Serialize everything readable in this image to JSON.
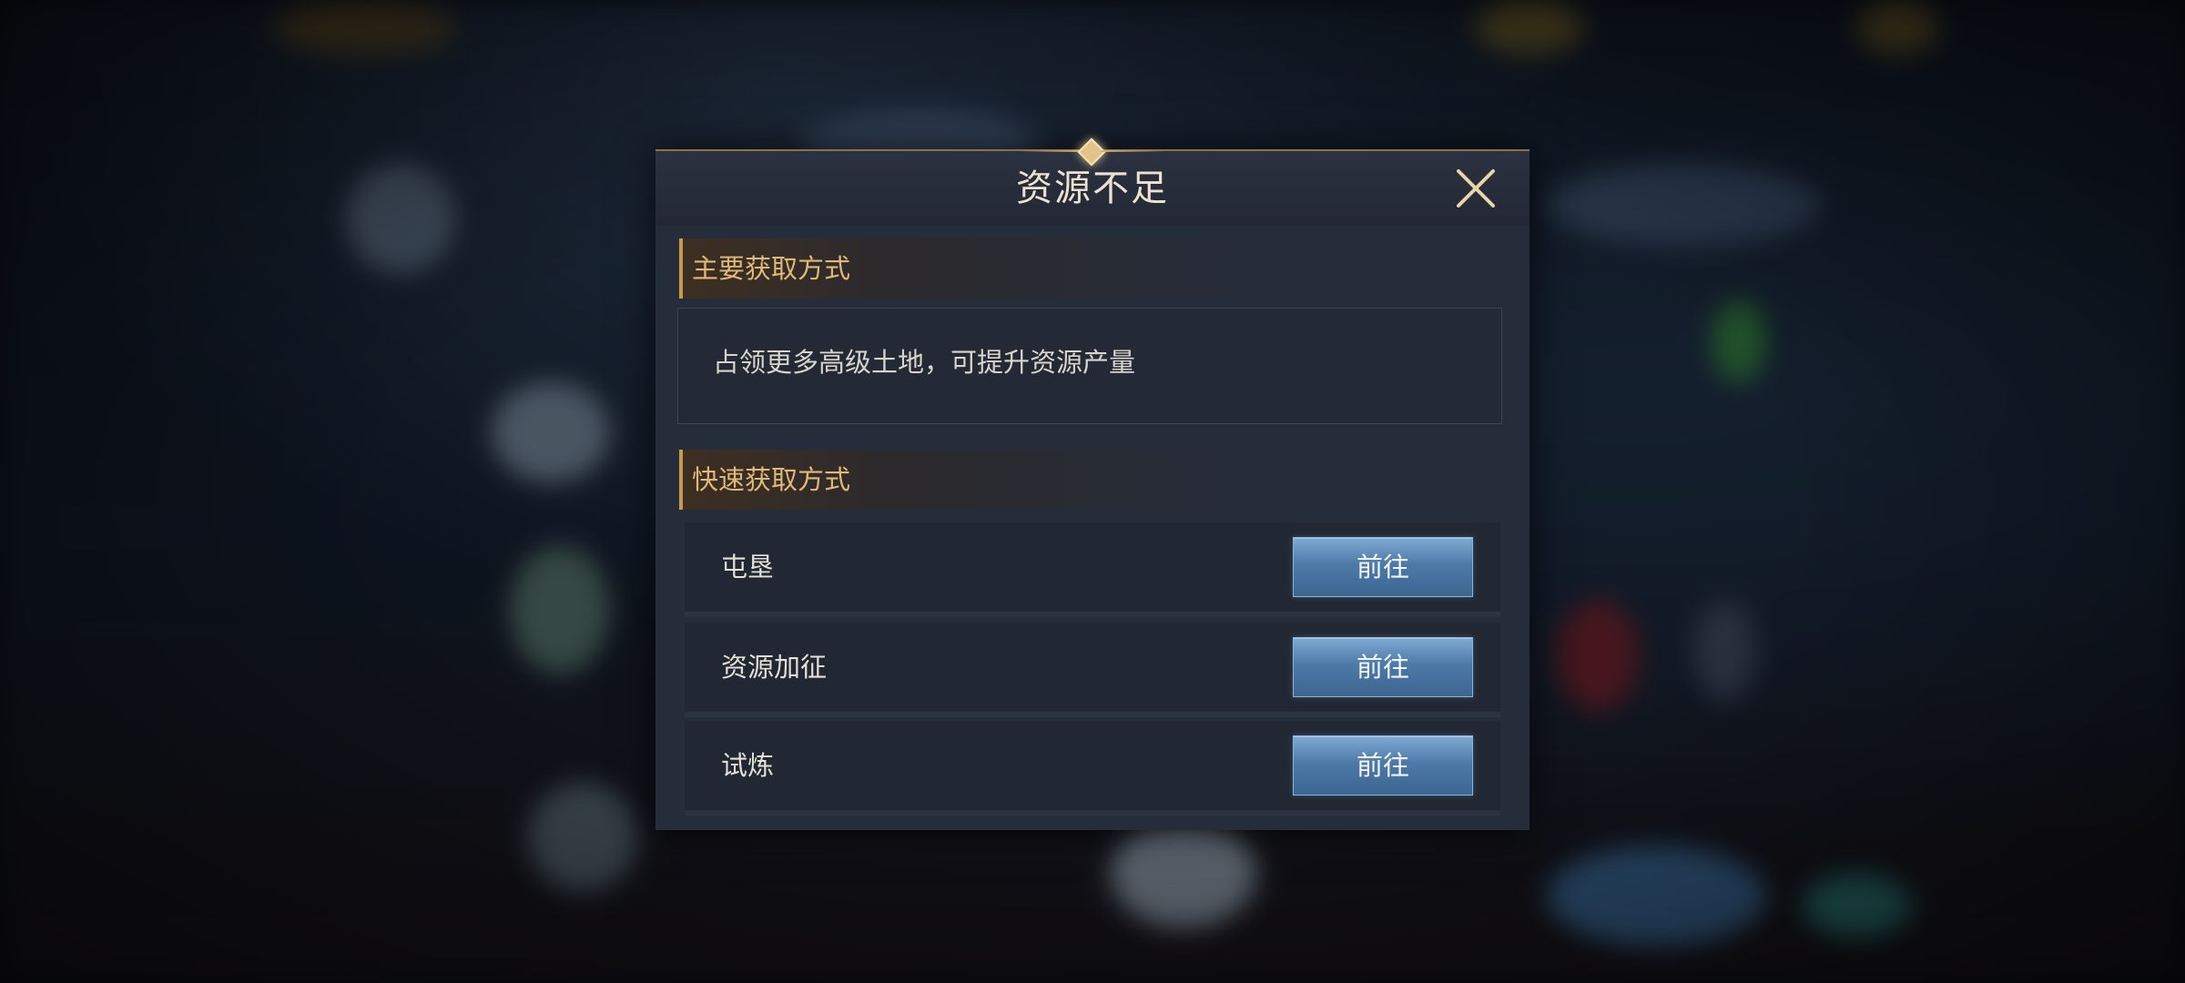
{
  "dialog": {
    "title": "资源不足",
    "close_icon": "close-icon"
  },
  "primary_section": {
    "header": "主要获取方式",
    "description": "占领更多高级土地，可提升资源产量"
  },
  "quick_section": {
    "header": "快速获取方式",
    "items": [
      {
        "label": "屯垦",
        "button": "前往"
      },
      {
        "label": "资源加征",
        "button": "前往"
      },
      {
        "label": "试炼",
        "button": "前往"
      }
    ]
  },
  "colors": {
    "accent_gold": "#e0b878",
    "button_blue": "#4d7aa8",
    "panel_bg": "#262d3a"
  }
}
